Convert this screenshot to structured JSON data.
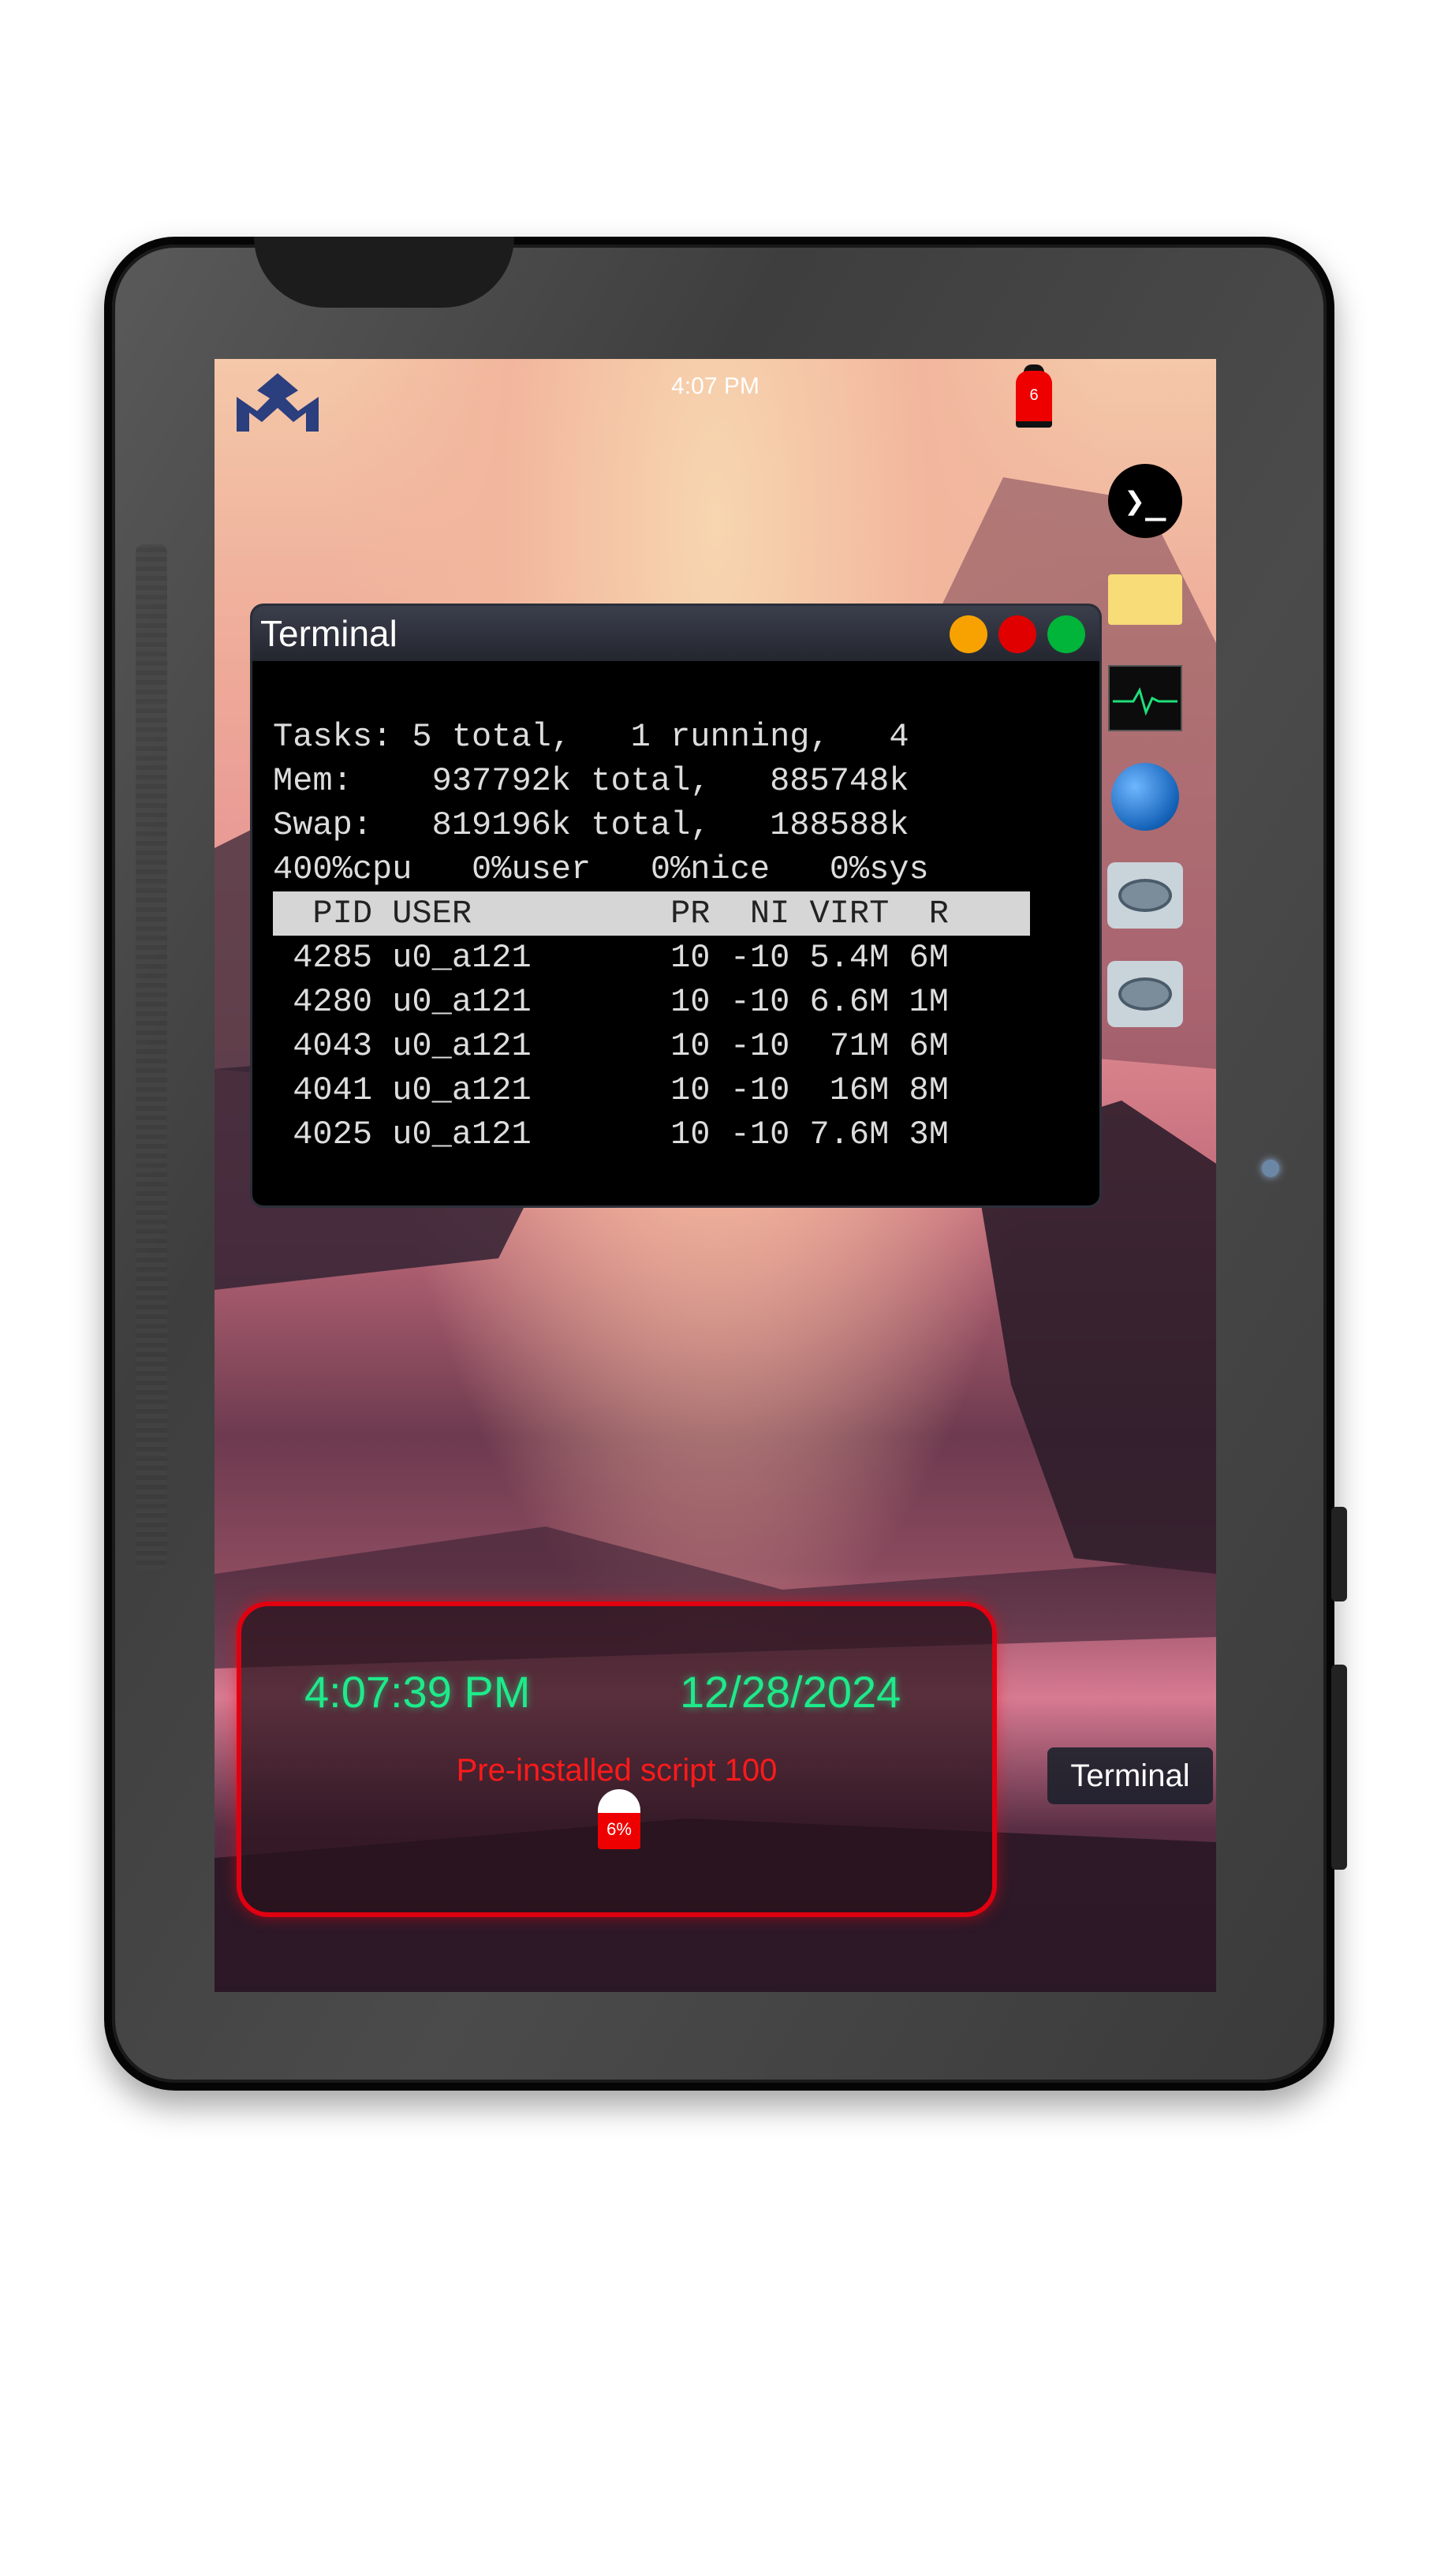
{
  "status_bar": {
    "time": "4:07 PM",
    "battery_level": "6",
    "logo_icon": "mm-logo-icon"
  },
  "dock": {
    "items": [
      {
        "name": "terminal",
        "icon": "terminal-prompt-icon",
        "glyph": "❯_"
      },
      {
        "name": "files",
        "icon": "folder-icon"
      },
      {
        "name": "system-monitor",
        "icon": "pulse-monitor-icon"
      },
      {
        "name": "browser",
        "icon": "globe-icon"
      },
      {
        "name": "nmap-1",
        "icon": "nmap-eye-icon"
      },
      {
        "name": "nmap-2",
        "icon": "nmap-eye-icon"
      }
    ]
  },
  "terminal": {
    "title": "Terminal",
    "lines": [
      "Tasks: 5 total,   1 running,   4",
      "Mem:    937792k total,   885748k",
      "Swap:   819196k total,   188588k",
      "400%cpu   0%user   0%nice   0%sys"
    ],
    "header": "  PID USER          PR  NI VIRT  R",
    "rows": [
      " 4285 u0_a121       10 -10 5.4M 6M",
      " 4280 u0_a121       10 -10 6.6M 1M",
      " 4043 u0_a121       10 -10  71M 6M",
      " 4041 u0_a121       10 -10  16M 8M",
      " 4025 u0_a121       10 -10 7.6M 3M"
    ]
  },
  "widget": {
    "time": "4:07:39 PM",
    "date": "12/28/2024",
    "script_text": "Pre-installed script 100",
    "battery_pct": "6%"
  },
  "taskbar": {
    "terminal_label": "Terminal"
  },
  "colors": {
    "clock_green": "#1eea8a",
    "alert_red": "#e00010",
    "folder_yellow": "#f7dc78"
  }
}
